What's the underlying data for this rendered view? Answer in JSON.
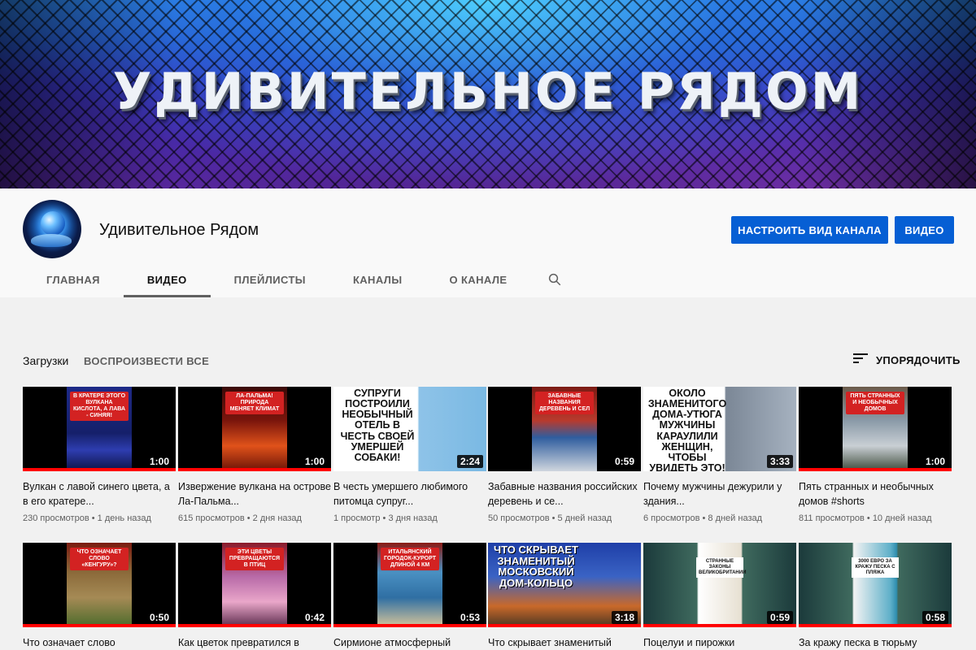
{
  "banner": {
    "title": "УДИВИТЕЛЬНОЕ РЯДОМ"
  },
  "channel": {
    "name": "Удивительное Рядом",
    "customize_label": "НАСТРОИТЬ ВИД КАНАЛА",
    "video_label": "ВИДЕО"
  },
  "tabs": [
    "ГЛАВНАЯ",
    "ВИДЕО",
    "ПЛЕЙЛИСТЫ",
    "КАНАЛЫ",
    "О КАНАЛЕ"
  ],
  "uploads": {
    "title": "Загрузки",
    "play_all": "ВОСПРОИЗВЕСТИ ВСЕ",
    "sort_label": "УПОРЯДОЧИТЬ"
  },
  "videos": [
    {
      "thumb_text": "В кратере этого вулкана кислота, а лава - синяя!",
      "duration": "1:00",
      "title": "Вулкан с лавой синего цвета, а в его кратере...",
      "views": "230 просмотров",
      "age": "1 день назад",
      "progress": 1.0
    },
    {
      "thumb_text": "Ла-Пальма! Природа меняет климат",
      "duration": "1:00",
      "title": "Извержение вулкана на острове Ла-Пальма...",
      "views": "615 просмотров",
      "age": "2 дня назад",
      "progress": 1.0
    },
    {
      "thumb_text": "Супруги построили необычный отель в честь своей умершей собаки!",
      "duration": "2:24",
      "title": "В честь умершего любимого питомца супруг...",
      "views": "1 просмотр",
      "age": "3 дня назад",
      "progress": 0
    },
    {
      "thumb_text": "Забавные названия деревень и сел",
      "duration": "0:59",
      "title": "Забавные названия российских деревень и се...",
      "views": "50 просмотров",
      "age": "5 дней назад",
      "progress": 0
    },
    {
      "thumb_text": "Около знаменитого дома-утюга мужчины караулили женщин, чтобы увидеть это!",
      "duration": "3:33",
      "title": "Почему мужчины дежурили у здания...",
      "views": "6 просмотров",
      "age": "8 дней назад",
      "progress": 0
    },
    {
      "thumb_text": "Пять странных и необычных домов",
      "duration": "1:00",
      "title": "Пять странных и необычных домов #shorts",
      "views": "811 просмотров",
      "age": "10 дней назад",
      "progress": 1.0
    },
    {
      "thumb_text": "Что означает слово «кенгуру»?",
      "duration": "0:50",
      "title": "Что означает слово",
      "views": "",
      "age": "",
      "progress": 1.0
    },
    {
      "thumb_text": "Эти цветы превращаются в птиц",
      "duration": "0:42",
      "title": "Как цветок превратился в",
      "views": "",
      "age": "",
      "progress": 1.0
    },
    {
      "thumb_text": "Итальянский городок-курорт длиной 4 км",
      "duration": "0:53",
      "title": "Сирмионе атмосферный",
      "views": "",
      "age": "",
      "progress": 1.0
    },
    {
      "thumb_text": "Что скрывает знаменитый московский дом-кольцо",
      "duration": "3:18",
      "title": "Что скрывает знаменитый",
      "views": "",
      "age": "",
      "progress": 1.0
    },
    {
      "thumb_text": "Странные законы Великобритании",
      "duration": "0:59",
      "title": "Поцелуи и пирожки",
      "views": "",
      "age": "",
      "progress": 1.0
    },
    {
      "thumb_text": "3000 евро за кражу песка с пляжа",
      "duration": "0:58",
      "title": "За кражу песка в тюрьму",
      "views": "",
      "age": "",
      "progress": 1.0
    }
  ],
  "colors": {
    "accent": "#065fd4",
    "progress": "#ff0000"
  }
}
